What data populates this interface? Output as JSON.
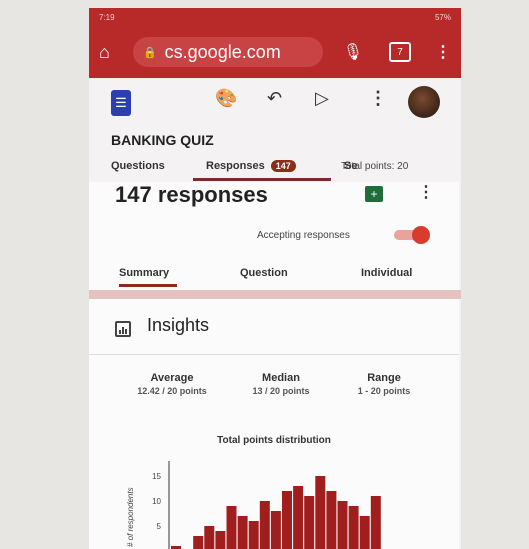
{
  "status": {
    "time": "7:19",
    "battery": "57%"
  },
  "browser": {
    "url": "cs.google.com",
    "tab_count": "7"
  },
  "form": {
    "title": "BANKING QUIZ"
  },
  "tabs": {
    "questions": "Questions",
    "responses": "Responses",
    "responses_badge": "147",
    "settings_fragment": "Se",
    "total_points": "Total points: 20"
  },
  "responses": {
    "count_title": "147 responses",
    "accepting_label": "Accepting responses"
  },
  "subtabs": {
    "summary": "Summary",
    "question": "Question",
    "individual": "Individual"
  },
  "insights": {
    "title": "Insights",
    "stats": [
      {
        "label": "Average",
        "value": "12.42 / 20 points"
      },
      {
        "label": "Median",
        "value": "13 / 20 points"
      },
      {
        "label": "Range",
        "value": "1 - 20 points"
      }
    ],
    "chart_title": "Total points distribution"
  },
  "colors": {
    "brand": "#b82a2a",
    "bar": "#a01e1e"
  },
  "chart_data": {
    "type": "bar",
    "title": "Total points distribution",
    "ylabel": "# of respondents",
    "ylim": [
      0,
      16
    ],
    "yticks": [
      5,
      10,
      15
    ],
    "values": [
      1,
      0,
      3,
      5,
      4,
      9,
      7,
      6,
      10,
      8,
      12,
      13,
      11,
      15,
      12,
      10,
      9,
      7,
      11
    ]
  }
}
